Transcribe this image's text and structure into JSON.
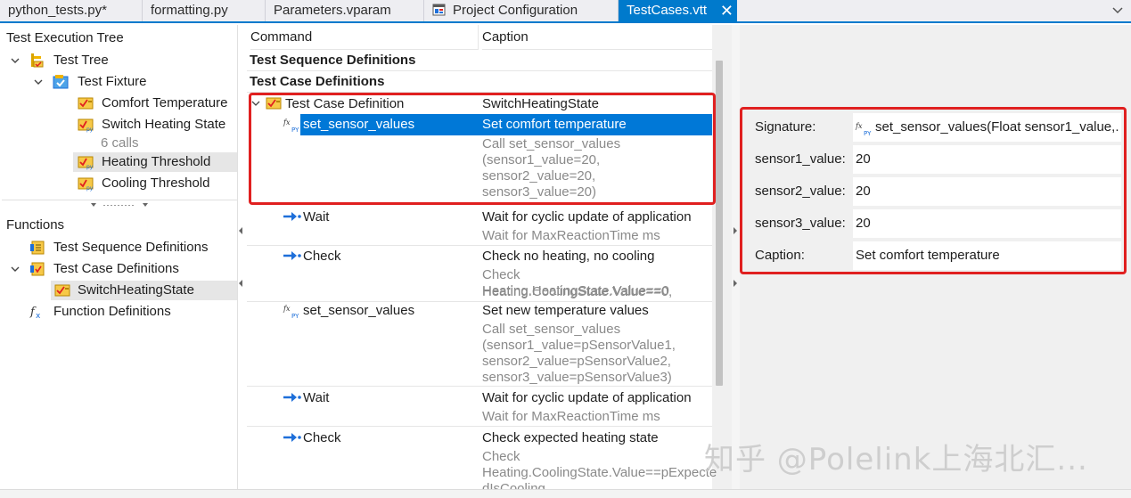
{
  "tabs": [
    {
      "label": "python_tests.py*",
      "icon": "none",
      "active": false
    },
    {
      "label": "formatting.py",
      "icon": "none",
      "active": false
    },
    {
      "label": "Parameters.vparam",
      "icon": "none",
      "active": false
    },
    {
      "label": "Project Configuration",
      "icon": "project-config-icon",
      "active": false
    },
    {
      "label": "TestCases.vtt",
      "icon": "none",
      "active": true
    }
  ],
  "tab_close": "✕",
  "left": {
    "execution_tree_title": "Test Execution Tree",
    "execution_tree": [
      {
        "label": "Test Tree",
        "icon": "test-tree-icon",
        "level": 0,
        "expanded": true
      },
      {
        "label": "Test Fixture",
        "icon": "test-fixture-icon",
        "level": 1,
        "expanded": true
      },
      {
        "label": "Comfort Temperature",
        "icon": "test-case-icon",
        "level": 2
      },
      {
        "label": "Switch Heating State",
        "sublabel": "6 calls",
        "icon": "test-case-py-icon",
        "level": 2
      },
      {
        "label": "Heating Threshold",
        "icon": "test-case-py-icon",
        "level": 2,
        "selected": true
      },
      {
        "label": "Cooling Threshold",
        "icon": "test-case-py-icon",
        "level": 2
      }
    ],
    "functions_title": "Functions",
    "functions": [
      {
        "label": "Test Sequence Definitions",
        "icon": "test-sequence-icon",
        "level": 0
      },
      {
        "label": "Test Case Definitions",
        "icon": "test-case-definitions-icon",
        "level": 0,
        "expanded": true
      },
      {
        "label": "SwitchHeatingState",
        "icon": "test-case-icon",
        "level": 1,
        "selected": true
      },
      {
        "label": "Function Definitions",
        "icon": "function-fx-icon",
        "level": 0
      }
    ]
  },
  "grid": {
    "headers": {
      "command": "Command",
      "caption": "Caption"
    },
    "sections": {
      "sequence_defs": "Test Sequence Definitions",
      "case_defs": "Test Case Definitions"
    },
    "rows": [
      {
        "command": "Test Case Definition",
        "caption_main": "SwitchHeatingState",
        "caption_sub": []
      },
      {
        "command": "set_sensor_values",
        "caption_main": "Set comfort temperature",
        "caption_sub": [
          "Call set_sensor_values",
          "(sensor1_value=20,",
          "sensor2_value=20,",
          "sensor3_value=20)"
        ]
      },
      {
        "command": "Wait",
        "caption_main": "Wait for cyclic update of application",
        "caption_sub": [
          "Wait for MaxReactionTime ms"
        ]
      },
      {
        "command": "Check",
        "caption_main": "Check no heating, no cooling",
        "caption_sub": [
          "Check Heating.CoolingState.Value==0,",
          "Heating.HeatingState.Value==0"
        ]
      },
      {
        "command": "set_sensor_values",
        "caption_main": "Set new temperature values",
        "caption_sub": [
          "Call set_sensor_values",
          "(sensor1_value=pSensorValue1,",
          "sensor2_value=pSensorValue2,",
          "sensor3_value=pSensorValue3)"
        ]
      },
      {
        "command": "Wait",
        "caption_main": "Wait for cyclic update of application",
        "caption_sub": [
          "Wait for MaxReactionTime ms"
        ]
      },
      {
        "command": "Check",
        "caption_main": "Check expected heating state",
        "caption_sub": [
          "Check",
          "Heating.CoolingState.Value==pExpecte",
          "dIsCooling"
        ]
      }
    ]
  },
  "properties": [
    {
      "label": "Signature:",
      "value": "set_sensor_values(Float sensor1_value,...",
      "icon": "function-py-icon"
    },
    {
      "label": "sensor1_value:",
      "value": "20"
    },
    {
      "label": "sensor2_value:",
      "value": "20"
    },
    {
      "label": "sensor3_value:",
      "value": "20"
    },
    {
      "label": "Caption:",
      "value": "Set comfort temperature"
    }
  ],
  "watermark": "知乎 @Polelink上海北汇...",
  "colors": {
    "accent": "#007acc",
    "selection": "#0078d7",
    "highlight_box": "#e02020",
    "check_arrow": "#1e6fd9"
  }
}
